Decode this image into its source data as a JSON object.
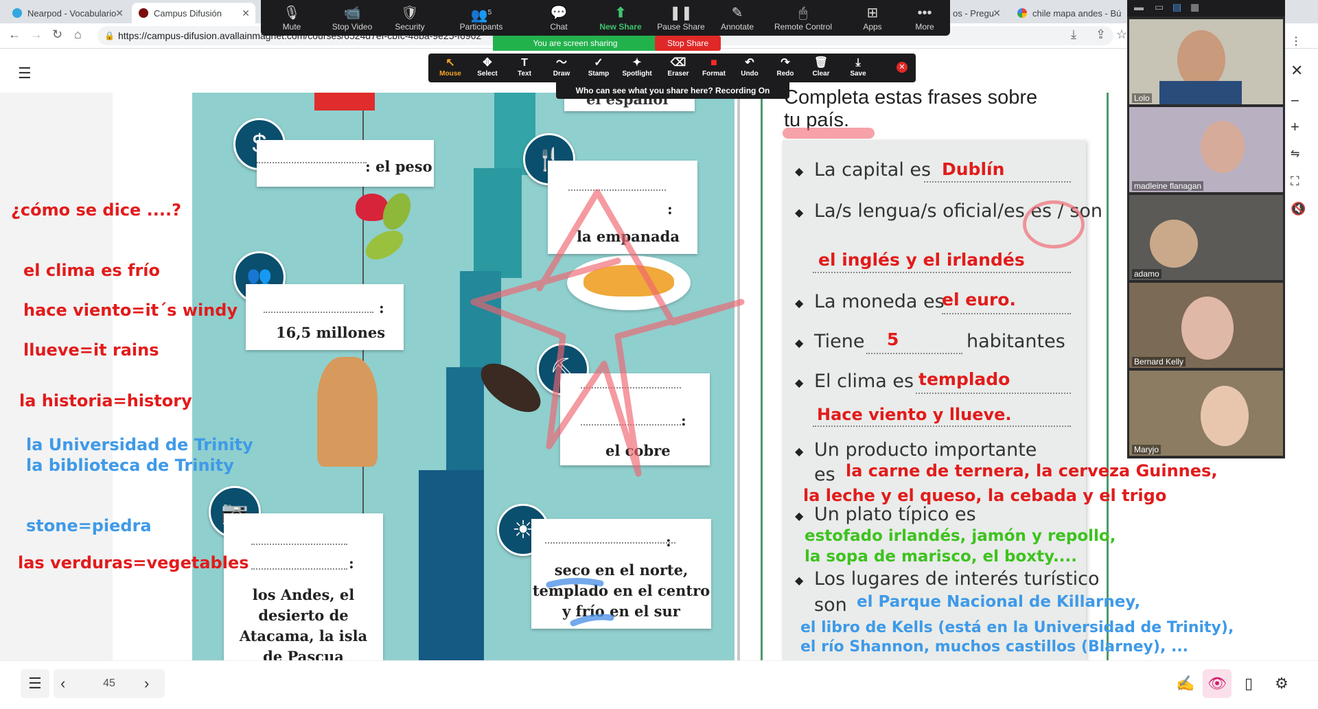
{
  "browser": {
    "tabs": [
      {
        "title": "Nearpod - Vocabulario"
      },
      {
        "title": "Campus Difusión"
      },
      {
        "title": "os - Pregu"
      },
      {
        "title": "chile mapa andes - Bú"
      }
    ],
    "url": "https://campus-difusion.avallainmagnet.com/courses/6524d7ef-cbfc-48ba-9e25-f6962"
  },
  "zoom": {
    "toolbar": [
      {
        "label": "Mute",
        "icon": "microphone-icon"
      },
      {
        "label": "Stop Video",
        "icon": "video-camera-icon"
      },
      {
        "label": "Security",
        "icon": "shield-icon"
      },
      {
        "label": "Participants",
        "icon": "people-icon",
        "count": "5"
      },
      {
        "label": "Chat",
        "icon": "chat-bubble-icon"
      },
      {
        "label": "New Share",
        "icon": "share-arrow-icon"
      },
      {
        "label": "Pause Share",
        "icon": "pause-icon"
      },
      {
        "label": "Annotate",
        "icon": "pencil-icon"
      },
      {
        "label": "Remote Control",
        "icon": "mouse-icon"
      },
      {
        "label": "Apps",
        "icon": "apps-icon"
      },
      {
        "label": "More",
        "icon": "ellipsis-icon"
      }
    ],
    "sharing_status": "You are screen sharing",
    "stop_share": "Stop Share",
    "annotate": [
      {
        "label": "Mouse",
        "glyph": "↖"
      },
      {
        "label": "Select",
        "glyph": "✥"
      },
      {
        "label": "Text",
        "glyph": "T"
      },
      {
        "label": "Draw",
        "glyph": "〜"
      },
      {
        "label": "Stamp",
        "glyph": "✓"
      },
      {
        "label": "Spotlight",
        "glyph": "✦"
      },
      {
        "label": "Eraser",
        "glyph": "⌫"
      },
      {
        "label": "Format",
        "glyph": "■"
      },
      {
        "label": "Undo",
        "glyph": "↶"
      },
      {
        "label": "Redo",
        "glyph": "↷"
      },
      {
        "label": "Clear",
        "glyph": "🗑"
      },
      {
        "label": "Save",
        "glyph": "⤓"
      }
    ],
    "who_can_see": "Who can see what you share here? Recording On",
    "participants": [
      {
        "name": "Lolo"
      },
      {
        "name": "madleine flanagan"
      },
      {
        "name": "adamo"
      },
      {
        "name": "Bernard Kelly"
      },
      {
        "name": "Maryjo"
      }
    ]
  },
  "map_cards": {
    "peso": ": el peso",
    "population": "16,5 millones",
    "geography": [
      "los Andes, el",
      "desierto de",
      "Atacama, la isla",
      "de Pascua"
    ],
    "food": "la empanada",
    "copper": "el cobre",
    "climate": [
      "seco en el norte,",
      "templado en el centro",
      "y frío en el sur"
    ],
    "top": "el español"
  },
  "exercise": {
    "title_line1": "Completa estas frases sobre",
    "title_line2": "tu país.",
    "items": [
      {
        "prompt": "La capital es",
        "answer": "Dublín"
      },
      {
        "prompt": "La/s lengua/s oficial/es es / son",
        "answer": "el inglés y el irlandés"
      },
      {
        "prompt": "La moneda es",
        "answer": "el euro."
      },
      {
        "prompt": "Tiene",
        "answer": "5",
        "suffix": "habitantes"
      },
      {
        "prompt": "El clima es",
        "answer": "templado",
        "extra": "Hace viento y llueve."
      },
      {
        "prompt": "Un producto importante",
        "prompt2": "es",
        "answer": "la carne de ternera, la cerveza Guinnes,",
        "answer2": "la leche y el queso, la cebada y el trigo"
      },
      {
        "prompt": "Un plato típico es",
        "answer": "estofado irlandés, jamón y repollo,",
        "answer2": "la sopa de marisco, el boxty...."
      },
      {
        "prompt": "Los lugares de interés turístico",
        "prompt2": "son",
        "answer": "el Parque Nacional de Killarney,",
        "answer2": "el libro de Kells (está en la Universidad de Trinity),",
        "answer3": "el río Shannon, muchos castillos (Blarney), ..."
      }
    ]
  },
  "left_notes": {
    "n1": "¿cómo se dice ....?",
    "n2": "el clima es frío",
    "n3": "hace viento=it´s windy",
    "n4": "llueve=it rains",
    "n5": "la historia=history",
    "n6": "la Universidad de Trinity",
    "n7": "la biblioteca de Trinity",
    "n8": "stone=piedra",
    "n9": "las verduras=vegetables"
  },
  "pager": {
    "page": "45"
  },
  "colors": {
    "annotation_red": "#e21b1b",
    "annotation_green": "#3ec21f",
    "annotation_blue": "#3f9ae8",
    "map_teal": "#8fcfce",
    "icon_navy": "#0a4f6e"
  }
}
